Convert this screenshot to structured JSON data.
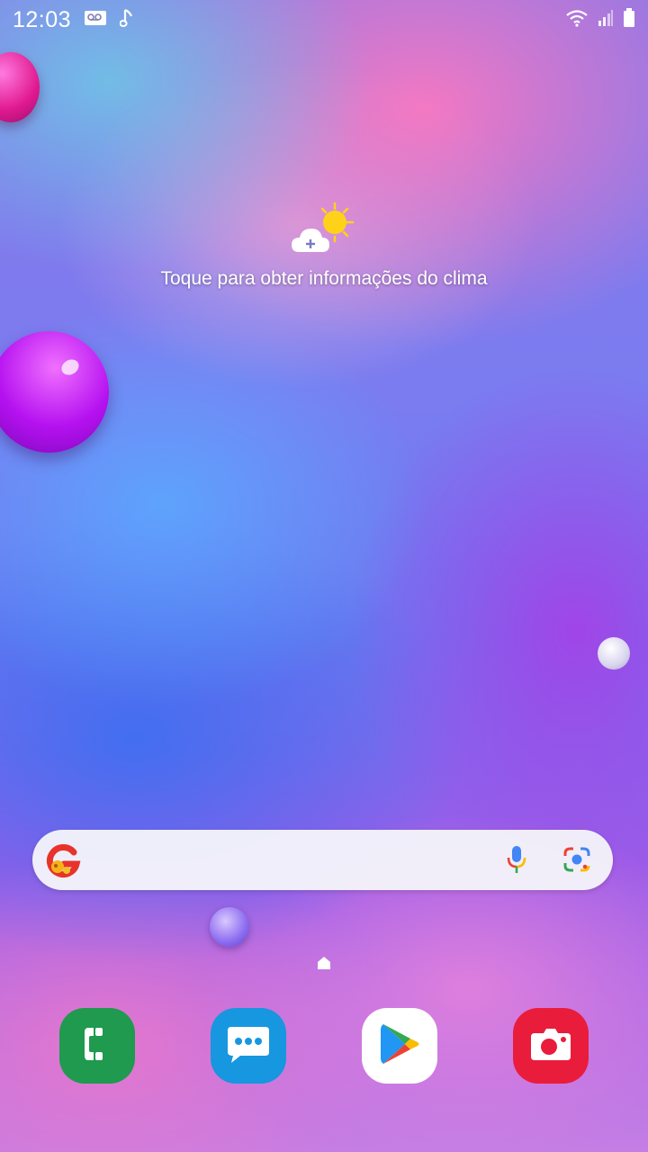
{
  "status_bar": {
    "time": "12:03",
    "icons_left": [
      "voicemail-icon",
      "music-note-icon"
    ],
    "icons_right": [
      "wifi-icon",
      "signal-icon",
      "battery-icon"
    ]
  },
  "weather_widget": {
    "text": "Toque para obter informações do clima",
    "icon": "weather-sun-cloud-icon"
  },
  "search_bar": {
    "logo": "google-doodle-logo",
    "icons": [
      "microphone-icon",
      "google-lens-icon"
    ]
  },
  "dock": {
    "apps": [
      {
        "name": "phone",
        "icon": "phone-icon",
        "color": "#1f9a4e"
      },
      {
        "name": "messages",
        "icon": "chat-bubble-icon",
        "color": "#1697e0"
      },
      {
        "name": "play-store",
        "icon": "play-store-icon",
        "color": "#ffffff"
      },
      {
        "name": "camera",
        "icon": "camera-icon",
        "color": "#ea1c3c"
      }
    ]
  }
}
